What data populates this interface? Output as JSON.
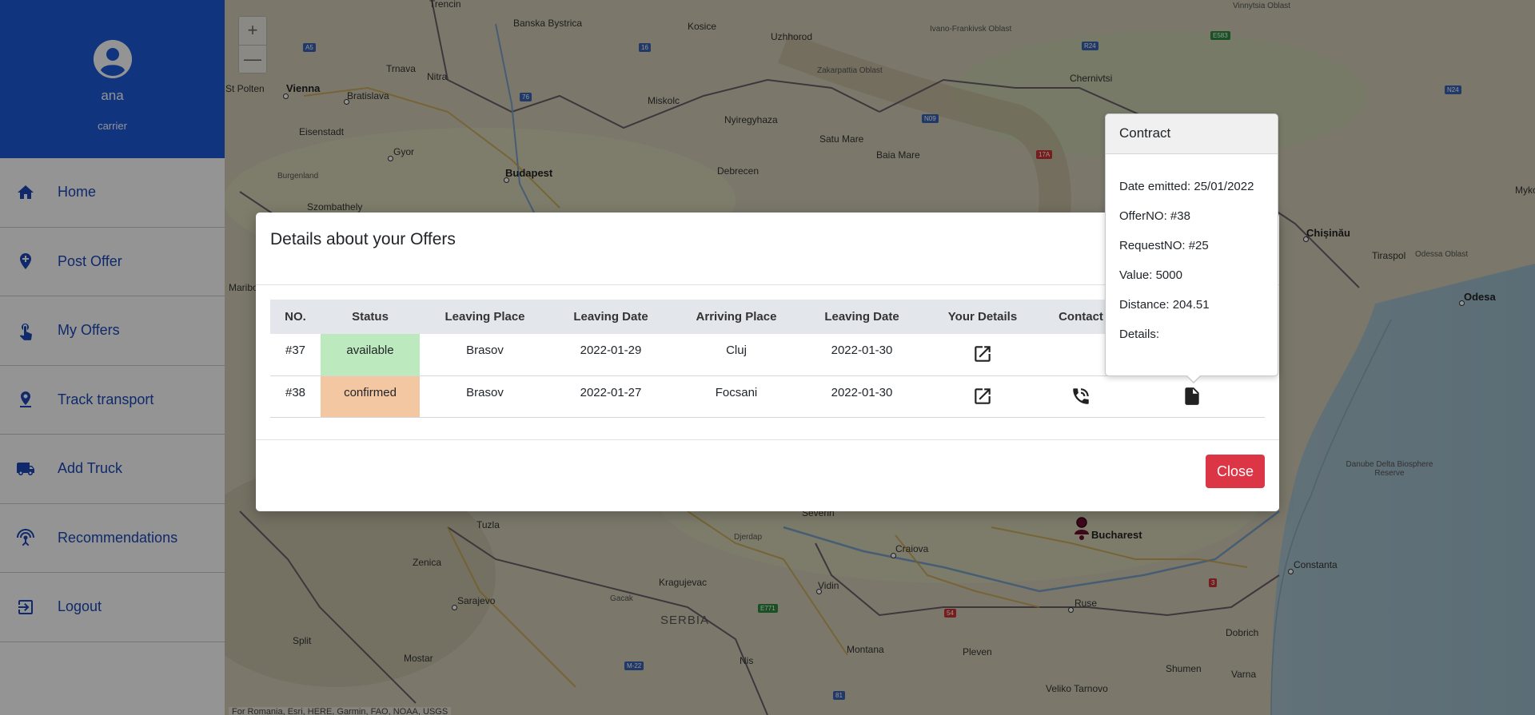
{
  "sidebar": {
    "user": {
      "name": "ana",
      "role": "carrier"
    },
    "items": [
      {
        "label": "Home",
        "icon": "home-icon"
      },
      {
        "label": "Post Offer",
        "icon": "add-location-icon"
      },
      {
        "label": "My Offers",
        "icon": "hand-pointer-icon"
      },
      {
        "label": "Track transport",
        "icon": "location-pin-icon"
      },
      {
        "label": "Add Truck",
        "icon": "truck-icon"
      },
      {
        "label": "Recommendations",
        "icon": "broadcast-icon"
      },
      {
        "label": "Logout",
        "icon": "logout-icon"
      }
    ]
  },
  "map": {
    "zoom_in": "+",
    "zoom_out": "—",
    "attribution": "For Romania, Esri, HERE, Garmin, FAO, NOAA, USGS",
    "labels": {
      "trencin": "Trencin",
      "banska": "Banska Bystrica",
      "kosice": "Kosice",
      "uzhhorod": "Uzhhorod",
      "ivano": "Ivano-Frankivsk Oblast",
      "vinnytsia": "Vinnytsia Oblast",
      "stpolten": "St Polten",
      "vienna": "Vienna",
      "trnava": "Trnava",
      "nitra": "Nitra",
      "bratislava": "Bratislava",
      "miskolc": "Miskolc",
      "zakarpattia": "Zakarpattia Oblast",
      "chernivtsi": "Chernivtsi",
      "eisenstadt": "Eisenstadt",
      "nyiregyhaza": "Nyiregyhaza",
      "gyor": "Gyor",
      "satumare": "Satu Mare",
      "baiamare": "Baia Mare",
      "burgenland": "Burgenland",
      "budapest": "Budapest",
      "debrecen": "Debrecen",
      "szombathely": "Szombathely",
      "chisinau": "Chișinău",
      "tiraspol": "Tiraspol",
      "odessaoblast": "Odessa Oblast",
      "odesa": "Odesa",
      "myko": "Myko",
      "danube": "Danube Delta Biosphere Reserve",
      "severin": "Severin",
      "bucharest": "Bucharest",
      "tuzla": "Tuzla",
      "craiova": "Craiova",
      "constanta": "Constanta",
      "zenica": "Zenica",
      "kragujevac": "Kragujevac",
      "sarajevo": "Sarajevo",
      "vidin": "Vidin",
      "serbia": "SERBIA",
      "ruse": "Ruse",
      "split": "Split",
      "dobrich": "Dobrich",
      "montana": "Montana",
      "mostar": "Mostar",
      "nis": "Nis",
      "pleven": "Pleven",
      "shumen": "Shumen",
      "varna": "Varna",
      "veliko": "Veliko Tarnovo",
      "maribor": "Maribo",
      "djerdap": "Djerdap",
      "gacak": "Gacak"
    }
  },
  "modal": {
    "title": "Details about your Offers",
    "close_label": "Close",
    "columns": [
      "NO.",
      "Status",
      "Leaving Place",
      "Leaving Date",
      "Arriving Place",
      "Leaving Date",
      "Your Details",
      "Contact",
      ""
    ],
    "rows": [
      {
        "no": "#37",
        "status": "available",
        "leaving_place": "Brasov",
        "leaving_date": "2022-01-29",
        "arriving_place": "Cluj",
        "arriving_date": "2022-01-30"
      },
      {
        "no": "#38",
        "status": "confirmed",
        "leaving_place": "Brasov",
        "leaving_date": "2022-01-27",
        "arriving_place": "Focsani",
        "arriving_date": "2022-01-30"
      }
    ]
  },
  "popover": {
    "title": "Contract",
    "date_emitted": "Date emitted: 25/01/2022",
    "offer_no": "OfferNO: #38",
    "request_no": "RequestNO: #25",
    "value": "Value: 5000",
    "distance": "Distance: 204.51",
    "details": "Details:"
  },
  "colors": {
    "sidebar_header": "#1e5bdb",
    "nav_text": "#1b47b8",
    "available": "#bde9bf",
    "confirmed": "#f3c7a2",
    "close_button": "#dc3545"
  }
}
